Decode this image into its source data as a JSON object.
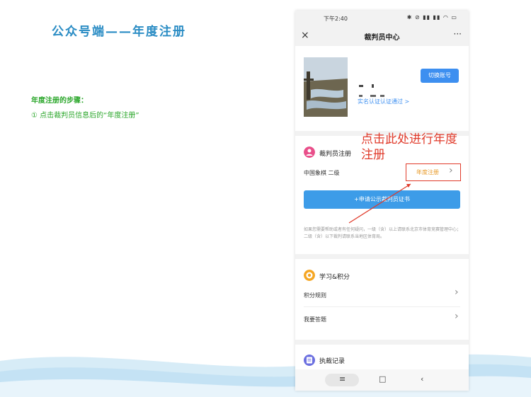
{
  "slide": {
    "title": "公众号端——年度注册",
    "steps_title": "年度注册的步骤：",
    "step_1": "① 点击裁判员信息后的“年度注册”",
    "callout": "点击此处进行年度注册"
  },
  "phone": {
    "status_time": "下午2:40",
    "status_icons": "✱ ⊘ ▮▮ ▮▮ ◠ ▭",
    "header": {
      "close": "×",
      "title": "裁判员中心",
      "more": "···"
    },
    "profile": {
      "switch_label": "切换账号",
      "verified_label": "实名认证认证通过 >"
    },
    "referee_section": {
      "title": "裁判员注册",
      "level": "中国象棋 二级",
      "annual_label": "年度注册",
      "apply_label": "+申请公示裁判员证书",
      "note": "如果您需要帮助或者有任何疑问，一级（含）以上请联系北京市体育竞赛管理中心；二级（含）以下裁判请联系当地区体育局。"
    },
    "study_section": {
      "title": "学习&积分",
      "rows": [
        "积分规则",
        "我要答题"
      ]
    },
    "record_section": {
      "title": "执裁记录"
    },
    "system_nav": {
      "menu": "≡",
      "home": "□",
      "back": "‹"
    }
  },
  "colors": {
    "accent_blue": "#3d8ff0",
    "annotation_red": "#e03a2a",
    "step_green": "#29a629",
    "title_blue": "#2a8cc4"
  }
}
